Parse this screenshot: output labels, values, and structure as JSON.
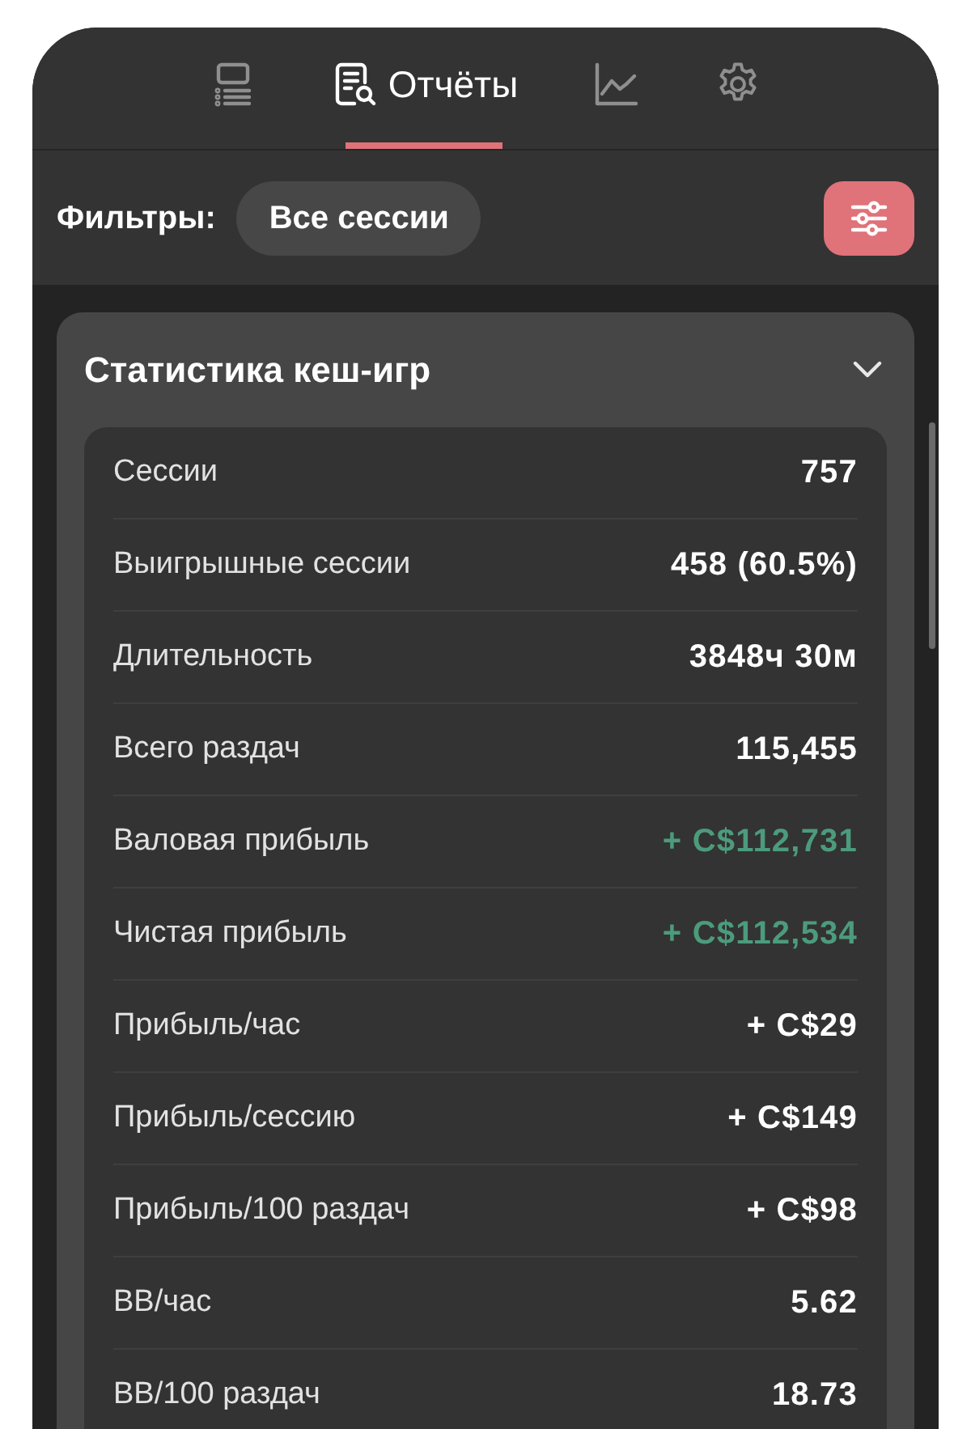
{
  "tabs": [
    {
      "kind": "list",
      "selected": false
    },
    {
      "kind": "reports",
      "label": "Отчёты",
      "selected": true
    },
    {
      "kind": "chart",
      "selected": false
    },
    {
      "kind": "settings",
      "selected": false
    }
  ],
  "filters": {
    "label": "Фильтры:",
    "chip": "Все сессии"
  },
  "card": {
    "title": "Статистика кеш-игр",
    "expanded": true,
    "rows": [
      {
        "label": "Сессии",
        "value": "757",
        "color": "#ffffff"
      },
      {
        "label": "Выигрышные сессии",
        "value": "458 (60.5%)",
        "color": "#ffffff"
      },
      {
        "label": "Длительность",
        "value": "3848ч 30м",
        "color": "#ffffff"
      },
      {
        "label": "Всего раздач",
        "value": "115,455",
        "color": "#ffffff"
      },
      {
        "label": "Валовая прибыль",
        "value": "+ C$112,731",
        "color": "#4c9b7c"
      },
      {
        "label": "Чистая прибыль",
        "value": "+ C$112,534",
        "color": "#4c9b7c"
      },
      {
        "label": "Прибыль/час",
        "value": "+ C$29",
        "color": "#ffffff"
      },
      {
        "label": "Прибыль/сессию",
        "value": "+ C$149",
        "color": "#ffffff"
      },
      {
        "label": "Прибыль/100 раздач",
        "value": "+ C$98",
        "color": "#ffffff"
      },
      {
        "label": "BB/час",
        "value": "5.62",
        "color": "#ffffff"
      },
      {
        "label": "BB/100 раздач",
        "value": "18.73",
        "color": "#ffffff"
      }
    ]
  }
}
